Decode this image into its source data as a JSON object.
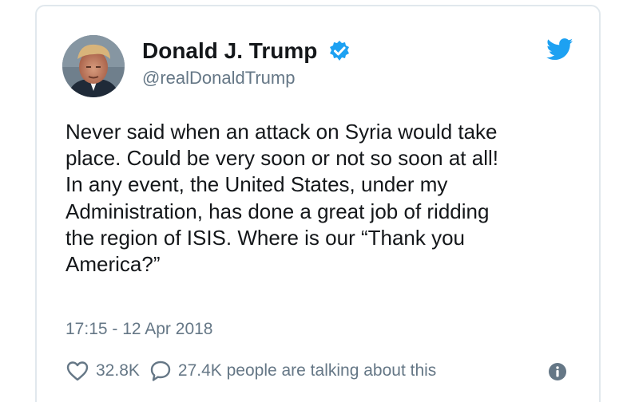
{
  "tweet": {
    "author_name": "Donald J. Trump",
    "handle": "@realDonaldTrump",
    "lines": [
      "Never said when an attack on Syria would take",
      "place. Could be very soon or not so soon at all!",
      "In any event, the United States, under my",
      "Administration, has done a great job of ridding",
      "the region of ISIS. Where is our “Thank you",
      "America?”"
    ],
    "timestamp": "17:15 - 12 Apr 2018",
    "likes": "32.8K",
    "talking": "27.4K people are talking about this"
  },
  "icons": {
    "verified": "verified-badge-icon",
    "brand": "twitter-bird-icon",
    "like": "heart-icon",
    "reply": "speech-bubble-icon",
    "info": "info-icon"
  },
  "colors": {
    "brand_blue": "#1da1f2",
    "text": "#14171a",
    "secondary": "#657786",
    "border": "#e1e8ed"
  }
}
